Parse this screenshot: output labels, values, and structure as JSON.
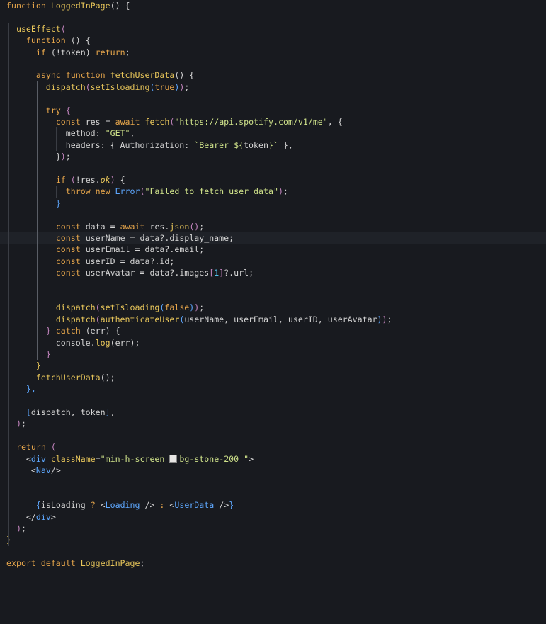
{
  "editor": {
    "colors": {
      "background": "#181a1f",
      "keyword": "#e5a54b",
      "function": "#e8c65a",
      "string": "#cfe28a",
      "identifier": "#d4d4d4",
      "punct": "#d4d4d4",
      "paren": "#c586c0",
      "tag": "#5ea8ff",
      "attr": "#e8c65a",
      "number": "#4fc1e9",
      "italic": "#e8c65a"
    },
    "lines": [
      {
        "tokens": [
          {
            "t": "function ",
            "c": "keyword"
          },
          {
            "t": "LoggedInPage",
            "c": "function"
          },
          {
            "t": "() {",
            "c": "punct"
          }
        ]
      },
      {
        "tokens": []
      },
      {
        "tokens": [
          {
            "t": "  "
          },
          {
            "t": "useEffect",
            "c": "function"
          },
          {
            "t": "(",
            "c": "paren"
          }
        ]
      },
      {
        "tokens": [
          {
            "t": "    "
          },
          {
            "t": "function ",
            "c": "keyword"
          },
          {
            "t": "() {",
            "c": "punct"
          }
        ]
      },
      {
        "tokens": [
          {
            "t": "      "
          },
          {
            "t": "if ",
            "c": "keyword"
          },
          {
            "t": "(!token) ",
            "c": "identifier"
          },
          {
            "t": "return",
            "c": "keyword"
          },
          {
            "t": ";",
            "c": "punct"
          }
        ]
      },
      {
        "tokens": []
      },
      {
        "tokens": [
          {
            "t": "      "
          },
          {
            "t": "async function ",
            "c": "keyword"
          },
          {
            "t": "fetchUserData",
            "c": "function"
          },
          {
            "t": "() {",
            "c": "punct"
          }
        ]
      },
      {
        "tokens": [
          {
            "t": "        "
          },
          {
            "t": "dispatch",
            "c": "function"
          },
          {
            "t": "(",
            "c": "paren"
          },
          {
            "t": "setIsloading",
            "c": "function"
          },
          {
            "t": "(",
            "c": "tag"
          },
          {
            "t": "true",
            "c": "keyword"
          },
          {
            "t": ")",
            "c": "tag"
          },
          {
            "t": ")",
            "c": "paren"
          },
          {
            "t": ";",
            "c": "punct"
          }
        ]
      },
      {
        "tokens": []
      },
      {
        "tokens": [
          {
            "t": "        "
          },
          {
            "t": "try ",
            "c": "keyword"
          },
          {
            "t": "{",
            "c": "paren"
          }
        ]
      },
      {
        "tokens": [
          {
            "t": "          "
          },
          {
            "t": "const ",
            "c": "keyword"
          },
          {
            "t": "res = ",
            "c": "identifier"
          },
          {
            "t": "await ",
            "c": "keyword"
          },
          {
            "t": "fetch",
            "c": "function"
          },
          {
            "t": "(",
            "c": "paren"
          },
          {
            "t": "\"",
            "c": "string"
          },
          {
            "t": "https://api.spotify.com/v1/me",
            "c": "string",
            "u": true
          },
          {
            "t": "\"",
            "c": "string"
          },
          {
            "t": ", {",
            "c": "punct"
          }
        ]
      },
      {
        "tokens": [
          {
            "t": "            method: ",
            "c": "identifier"
          },
          {
            "t": "\"GET\"",
            "c": "string"
          },
          {
            "t": ",",
            "c": "punct"
          }
        ]
      },
      {
        "tokens": [
          {
            "t": "            headers: { Authorization: ",
            "c": "identifier"
          },
          {
            "t": "`Bearer ${",
            "c": "string"
          },
          {
            "t": "token",
            "c": "identifier"
          },
          {
            "t": "}`",
            "c": "string"
          },
          {
            "t": " },",
            "c": "punct"
          }
        ]
      },
      {
        "tokens": [
          {
            "t": "          "
          },
          {
            "t": "}",
            "c": "punct"
          },
          {
            "t": ")",
            "c": "paren"
          },
          {
            "t": ";",
            "c": "punct"
          }
        ]
      },
      {
        "tokens": []
      },
      {
        "tokens": [
          {
            "t": "          "
          },
          {
            "t": "if ",
            "c": "keyword"
          },
          {
            "t": "(",
            "c": "paren"
          },
          {
            "t": "!res.",
            "c": "identifier"
          },
          {
            "t": "ok",
            "c": "italic",
            "i": true
          },
          {
            "t": ")",
            "c": "paren"
          },
          {
            "t": " {",
            "c": "punct"
          }
        ]
      },
      {
        "tokens": [
          {
            "t": "            "
          },
          {
            "t": "throw new ",
            "c": "keyword"
          },
          {
            "t": "Error",
            "c": "tag"
          },
          {
            "t": "(",
            "c": "paren"
          },
          {
            "t": "\"Failed to fetch user data\"",
            "c": "string"
          },
          {
            "t": ")",
            "c": "paren"
          },
          {
            "t": ";",
            "c": "punct"
          }
        ]
      },
      {
        "tokens": [
          {
            "t": "          "
          },
          {
            "t": "}",
            "c": "tag"
          }
        ]
      },
      {
        "tokens": []
      },
      {
        "tokens": [
          {
            "t": "          "
          },
          {
            "t": "const ",
            "c": "keyword"
          },
          {
            "t": "data = ",
            "c": "identifier"
          },
          {
            "t": "await ",
            "c": "keyword"
          },
          {
            "t": "res.",
            "c": "identifier"
          },
          {
            "t": "json",
            "c": "function"
          },
          {
            "t": "()",
            "c": "paren"
          },
          {
            "t": ";",
            "c": "punct"
          }
        ]
      },
      {
        "tokens": [
          {
            "t": "          "
          },
          {
            "t": "const ",
            "c": "keyword"
          },
          {
            "t": "userName = data?.display_name;",
            "c": "identifier"
          }
        ],
        "current": true
      },
      {
        "tokens": [
          {
            "t": "          "
          },
          {
            "t": "const ",
            "c": "keyword"
          },
          {
            "t": "userEmail = data?.email;",
            "c": "identifier"
          }
        ]
      },
      {
        "tokens": [
          {
            "t": "          "
          },
          {
            "t": "const ",
            "c": "keyword"
          },
          {
            "t": "userID = data?.id;",
            "c": "identifier"
          }
        ]
      },
      {
        "tokens": [
          {
            "t": "          "
          },
          {
            "t": "const ",
            "c": "keyword"
          },
          {
            "t": "userAvatar = data?.images",
            "c": "identifier"
          },
          {
            "t": "[",
            "c": "paren"
          },
          {
            "t": "1",
            "c": "number"
          },
          {
            "t": "]",
            "c": "paren"
          },
          {
            "t": "?.url;",
            "c": "identifier"
          }
        ]
      },
      {
        "tokens": []
      },
      {
        "tokens": []
      },
      {
        "tokens": [
          {
            "t": "          "
          },
          {
            "t": "dispatch",
            "c": "function"
          },
          {
            "t": "(",
            "c": "paren"
          },
          {
            "t": "setIsloading",
            "c": "function"
          },
          {
            "t": "(",
            "c": "tag"
          },
          {
            "t": "false",
            "c": "keyword"
          },
          {
            "t": ")",
            "c": "tag"
          },
          {
            "t": ")",
            "c": "paren"
          },
          {
            "t": ";",
            "c": "punct"
          }
        ]
      },
      {
        "tokens": [
          {
            "t": "          "
          },
          {
            "t": "dispatch",
            "c": "function"
          },
          {
            "t": "(",
            "c": "paren"
          },
          {
            "t": "authenticateUser",
            "c": "function"
          },
          {
            "t": "(",
            "c": "tag"
          },
          {
            "t": "userName, userEmail, userID, userAvatar",
            "c": "identifier"
          },
          {
            "t": ")",
            "c": "tag"
          },
          {
            "t": ")",
            "c": "paren"
          },
          {
            "t": ";",
            "c": "punct"
          }
        ]
      },
      {
        "tokens": [
          {
            "t": "        "
          },
          {
            "t": "}",
            "c": "paren"
          },
          {
            "t": " catch ",
            "c": "keyword"
          },
          {
            "t": "(err) {",
            "c": "identifier"
          }
        ]
      },
      {
        "tokens": [
          {
            "t": "          console.",
            "c": "identifier"
          },
          {
            "t": "log",
            "c": "function"
          },
          {
            "t": "(err);",
            "c": "identifier"
          }
        ]
      },
      {
        "tokens": [
          {
            "t": "        "
          },
          {
            "t": "}",
            "c": "paren"
          }
        ]
      },
      {
        "tokens": [
          {
            "t": "      "
          },
          {
            "t": "}",
            "c": "function"
          }
        ]
      },
      {
        "tokens": [
          {
            "t": "      "
          },
          {
            "t": "fetchUserData",
            "c": "function"
          },
          {
            "t": "();",
            "c": "punct"
          }
        ]
      },
      {
        "tokens": [
          {
            "t": "    "
          },
          {
            "t": "},",
            "c": "tag"
          }
        ]
      },
      {
        "tokens": []
      },
      {
        "tokens": [
          {
            "t": "    "
          },
          {
            "t": "[",
            "c": "tag"
          },
          {
            "t": "dispatch, token",
            "c": "identifier"
          },
          {
            "t": "]",
            "c": "tag"
          },
          {
            "t": ",",
            "c": "punct"
          }
        ]
      },
      {
        "tokens": [
          {
            "t": "  "
          },
          {
            "t": ")",
            "c": "paren"
          },
          {
            "t": ";",
            "c": "punct"
          }
        ]
      },
      {
        "tokens": []
      },
      {
        "tokens": [
          {
            "t": "  "
          },
          {
            "t": "return ",
            "c": "keyword"
          },
          {
            "t": "(",
            "c": "paren"
          }
        ]
      },
      {
        "tokens": [
          {
            "t": "    "
          },
          {
            "t": "<",
            "c": "punct"
          },
          {
            "t": "div ",
            "c": "tag"
          },
          {
            "t": "className",
            "c": "attr"
          },
          {
            "t": "=",
            "c": "punct"
          },
          {
            "t": "\"min-h-screen ",
            "c": "string"
          },
          {
            "t": "",
            "sw": true
          },
          {
            "t": "bg-stone-200 \"",
            "c": "string"
          },
          {
            "t": ">",
            "c": "punct"
          }
        ]
      },
      {
        "tokens": [
          {
            "t": "     "
          },
          {
            "t": "<",
            "c": "punct"
          },
          {
            "t": "Nav",
            "c": "tag"
          },
          {
            "t": "/>",
            "c": "punct"
          }
        ]
      },
      {
        "tokens": []
      },
      {
        "tokens": []
      },
      {
        "tokens": [
          {
            "t": "      "
          },
          {
            "t": "{",
            "c": "tag"
          },
          {
            "t": "isLoading ",
            "c": "identifier"
          },
          {
            "t": "? ",
            "c": "keyword"
          },
          {
            "t": "<",
            "c": "punct"
          },
          {
            "t": "Loading ",
            "c": "tag"
          },
          {
            "t": "/>",
            "c": "punct"
          },
          {
            "t": " : ",
            "c": "keyword"
          },
          {
            "t": "<",
            "c": "punct"
          },
          {
            "t": "UserData ",
            "c": "tag"
          },
          {
            "t": "/>",
            "c": "punct"
          },
          {
            "t": "}",
            "c": "tag"
          }
        ]
      },
      {
        "tokens": [
          {
            "t": "    "
          },
          {
            "t": "</",
            "c": "punct"
          },
          {
            "t": "div",
            "c": "tag"
          },
          {
            "t": ">",
            "c": "punct"
          }
        ]
      },
      {
        "tokens": [
          {
            "t": "  "
          },
          {
            "t": ")",
            "c": "paren"
          },
          {
            "t": ";",
            "c": "punct"
          }
        ]
      },
      {
        "tokens": [
          {
            "t": "}",
            "c": "function"
          }
        ]
      },
      {
        "tokens": []
      },
      {
        "tokens": [
          {
            "t": "export default ",
            "c": "keyword"
          },
          {
            "t": "LoggedInPage",
            "c": "function"
          },
          {
            "t": ";",
            "c": "punct"
          }
        ]
      }
    ]
  }
}
